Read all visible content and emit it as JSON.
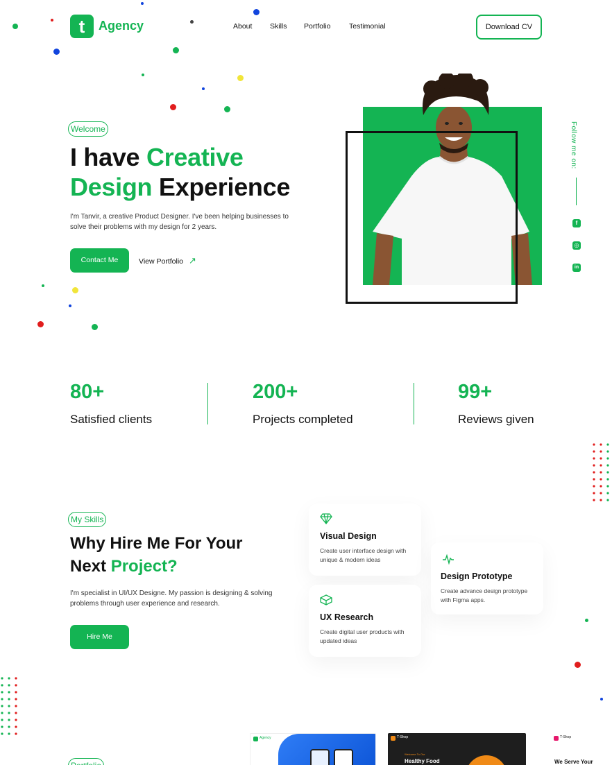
{
  "header": {
    "logo_letter": "t",
    "logo_text": "Agency",
    "nav": [
      "About",
      "Skills",
      "Portfolio",
      "Testimonial"
    ],
    "cta": "Download CV"
  },
  "hero": {
    "badge": "Welcome",
    "title_part1": "I have ",
    "title_highlight1": "Creative",
    "title_highlight2": "Design",
    "title_part2": " Experience",
    "description": "I'm Tanvir, a creative Product Designer. I've been helping businesses to solve their problems with my design for 2 years.",
    "primary_button": "Contact Me",
    "secondary_link": "View Portfolio",
    "arrow": "↗",
    "follow_label": "Follow me on:"
  },
  "social": [
    {
      "icon": "facebook-icon",
      "glyph": "f"
    },
    {
      "icon": "instagram-icon",
      "glyph": "◎"
    },
    {
      "icon": "linkedin-icon",
      "glyph": "in"
    }
  ],
  "stats": [
    {
      "number": "80+",
      "label": "Satisfied clients"
    },
    {
      "number": "200+",
      "label": "Projects completed"
    },
    {
      "number": "99+",
      "label": "Reviews given"
    }
  ],
  "skills": {
    "badge": "My Skills",
    "title_line1": "Why Hire Me For Your",
    "title_line2_plain": "Next ",
    "title_line2_highlight": "Project?",
    "description": "I'm specialist in UI/UX Designe. My passion is designing & solving problems through user experience and research.",
    "button": "Hire Me",
    "cards": [
      {
        "icon": "diamond-icon",
        "title": "Visual Design",
        "desc": "Create user interface design with unique & modern ideas"
      },
      {
        "icon": "pulse-icon",
        "title": "Design Prototype",
        "desc": "Create advance design prototype with Figma apps."
      },
      {
        "icon": "box-icon",
        "title": "UX Research",
        "desc": "Create digital user products with updated ideas"
      }
    ]
  },
  "portfolio": {
    "badge": "Portfolio",
    "thumb2_brand": "T-Shop",
    "thumb2_welcome": "Welcome To Our",
    "thumb2_heading": "Healthy Food",
    "thumb3_brand": "T-Shop",
    "thumb3_heading": "We Serve Your",
    "thumb1_brand": "Agency"
  },
  "colors": {
    "accent": "#14b453",
    "text": "#111111",
    "red_dot": "#e11d1d",
    "blue_dot": "#1144dd",
    "yellow_dot": "#f1e53a"
  }
}
